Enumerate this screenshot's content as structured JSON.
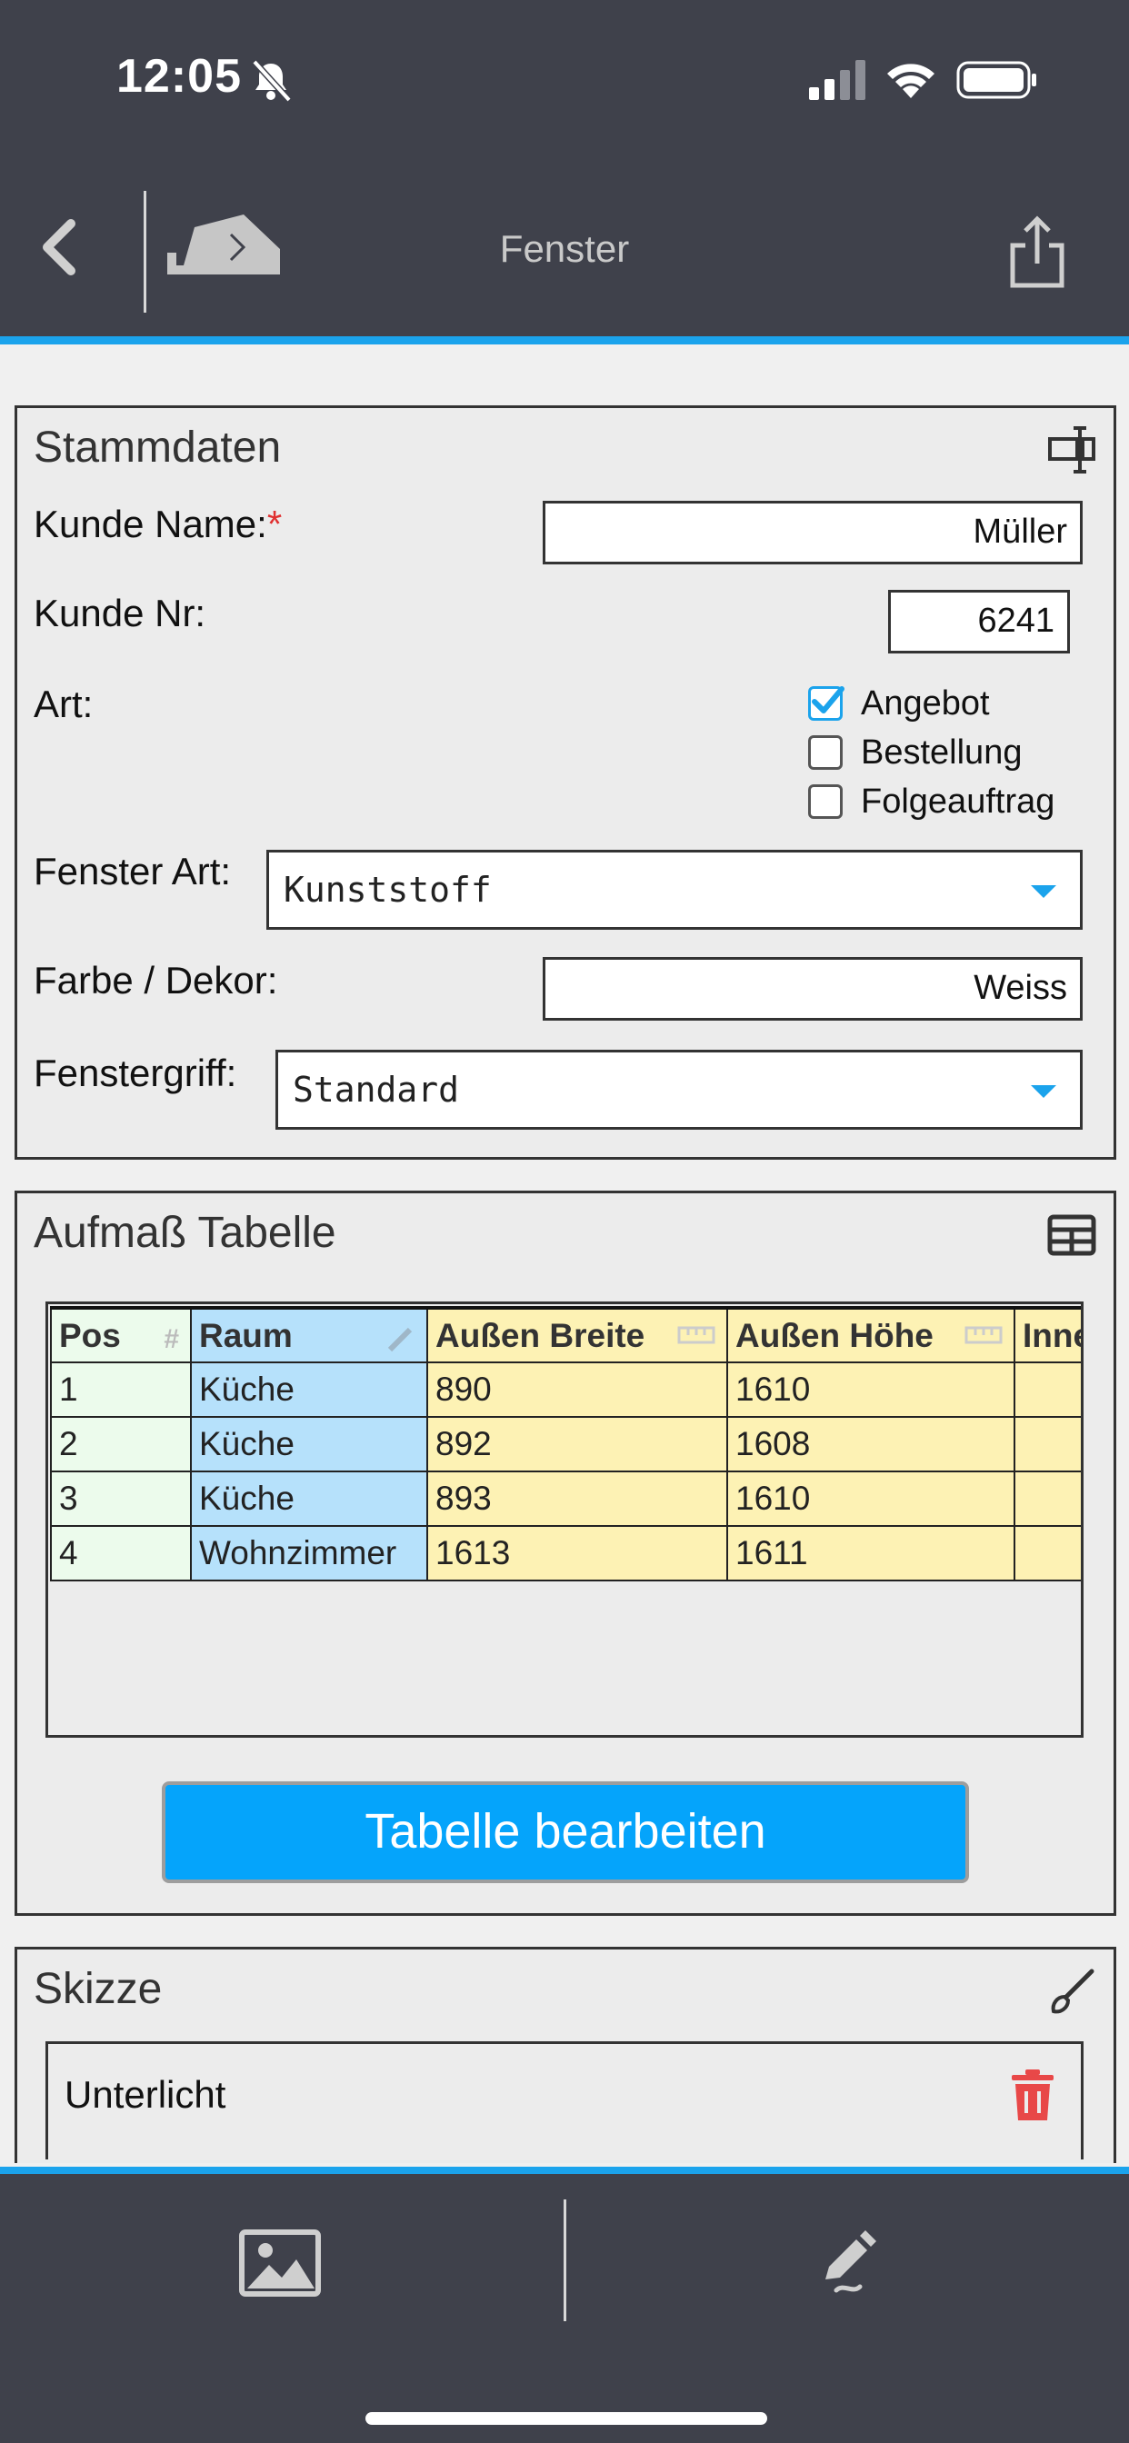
{
  "status_bar": {
    "time": "12:05",
    "icons": [
      "bell-slash-icon",
      "cellular-signal-icon",
      "wifi-icon",
      "battery-icon"
    ]
  },
  "header": {
    "title": "Fenster",
    "back_icon": "chevron-left-icon",
    "device_icon": "bluetooth-device-icon",
    "share_icon": "share-icon"
  },
  "stammdaten": {
    "title": "Stammdaten",
    "icon": "input-field-icon",
    "kunde_name_label": "Kunde Name:",
    "kunde_name_required": "*",
    "kunde_name_value": "Müller",
    "kunde_nr_label": "Kunde Nr:",
    "kunde_nr_value": "6241",
    "art_label": "Art:",
    "art_options": [
      {
        "label": "Angebot",
        "checked": true
      },
      {
        "label": "Bestellung",
        "checked": false
      },
      {
        "label": "Folgeauftrag",
        "checked": false
      }
    ],
    "fenster_art_label": "Fenster Art:",
    "fenster_art_value": "Kunststoff",
    "farbe_label": "Farbe / Dekor:",
    "farbe_value": "Weiss",
    "fenstergriff_label": "Fenstergriff:",
    "fenstergriff_value": "Standard"
  },
  "aufmass": {
    "title": "Aufmaß Tabelle",
    "icon": "table-icon",
    "columns": [
      "Pos",
      "Raum",
      "Außen Breite",
      "Außen Höhe",
      "Inne"
    ],
    "column_icons": [
      "hash-icon",
      "pencil-icon",
      "ruler-icon",
      "ruler-icon"
    ],
    "rows": [
      [
        "1",
        "Küche",
        "890",
        "1610",
        ""
      ],
      [
        "2",
        "Küche",
        "892",
        "1608",
        ""
      ],
      [
        "3",
        "Küche",
        "893",
        "1610",
        ""
      ],
      [
        "4",
        " Wohnzimmer",
        "1613",
        "1611",
        ""
      ]
    ],
    "edit_button": "Tabelle bearbeiten"
  },
  "skizze": {
    "title": "Skizze",
    "icon": "brush-icon",
    "item_label": "Unterlicht",
    "delete_icon": "trash-icon"
  },
  "bottom_bar": {
    "left_icon": "image-icon",
    "right_icon": "pen-edit-icon"
  },
  "colors": {
    "header_bg": "#3f414b",
    "accent": "#1ba3ec",
    "button_bg": "#05a4fb",
    "raum_col": "#b6e1fb",
    "measure_col": "#fdf2b4",
    "pos_col": "#ecfbec",
    "delete": "#e84848"
  }
}
